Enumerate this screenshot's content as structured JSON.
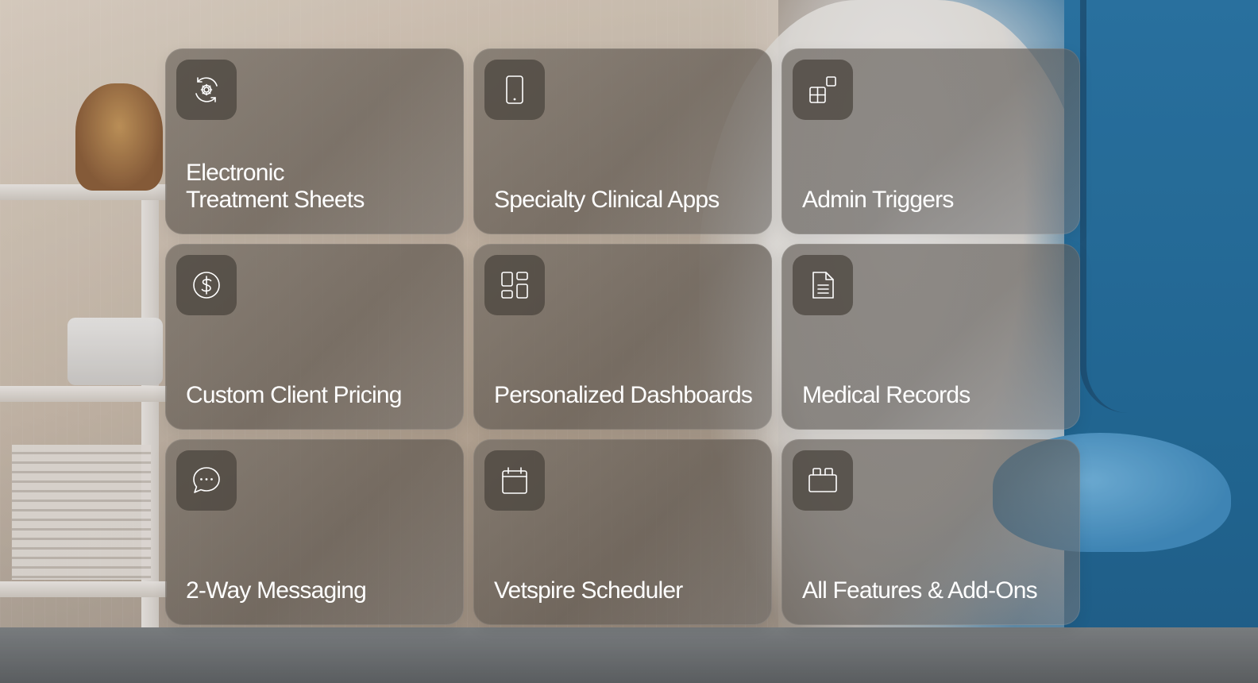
{
  "background": {
    "description_colors": {
      "accent_scrubs": "#1e6fa5",
      "glove": "#5aa8da",
      "card_overlay": "#6e665e"
    }
  },
  "features": [
    {
      "label": "Electronic\nTreatment Sheets",
      "icon": "settings-refresh-icon"
    },
    {
      "label": "Specialty Clinical Apps",
      "icon": "tablet-icon"
    },
    {
      "label": "Admin Triggers",
      "icon": "widgets-icon"
    },
    {
      "label": "Custom Client Pricing",
      "icon": "dollar-circle-icon"
    },
    {
      "label": "Personalized Dashboards",
      "icon": "dashboard-icon"
    },
    {
      "label": "Medical Records",
      "icon": "document-icon"
    },
    {
      "label": "2-Way Messaging",
      "icon": "chat-bubble-icon"
    },
    {
      "label": "Vetspire Scheduler",
      "icon": "calendar-icon"
    },
    {
      "label": "All Features & Add-Ons",
      "icon": "briefcase-icon"
    }
  ]
}
